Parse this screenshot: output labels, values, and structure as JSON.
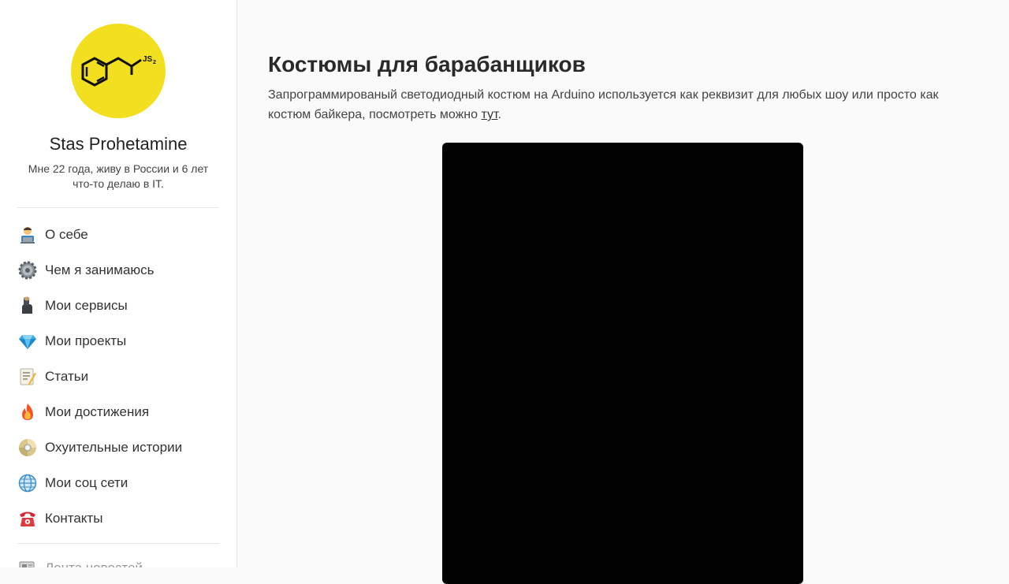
{
  "profile": {
    "name": "Stas Prohetamine",
    "bio": "Мне 22 года, живу в России и 6 лет что-то делаю в IT.",
    "logo_text": "JS₂"
  },
  "nav": {
    "items": [
      {
        "label": "О себе",
        "icon": "technologist-icon"
      },
      {
        "label": "Чем я занимаюсь",
        "icon": "gear-icon"
      },
      {
        "label": "Мои сервисы",
        "icon": "flexed-biceps-icon"
      },
      {
        "label": "Мои проекты",
        "icon": "gem-icon"
      },
      {
        "label": "Статьи",
        "icon": "memo-icon"
      },
      {
        "label": "Мои достижения",
        "icon": "fire-icon"
      },
      {
        "label": "Охуительные истории",
        "icon": "dvd-icon"
      },
      {
        "label": "Мои соц сети",
        "icon": "globe-icon"
      },
      {
        "label": "Контакты",
        "icon": "telephone-icon"
      }
    ],
    "extra": {
      "label": "Лента новостей",
      "icon": "newspaper-icon"
    }
  },
  "main": {
    "title": "Костюмы для барабанщиков",
    "description": "Запрограммированый светодиодный костюм на Arduino используется как реквизит для любых шоу или просто как костюм байкера, посмотреть можно ",
    "link_text": "тут",
    "trailing": "."
  },
  "colors": {
    "avatar_bg": "#f2df1f",
    "video_bg": "#020101",
    "page_bg": "#fafafa"
  }
}
